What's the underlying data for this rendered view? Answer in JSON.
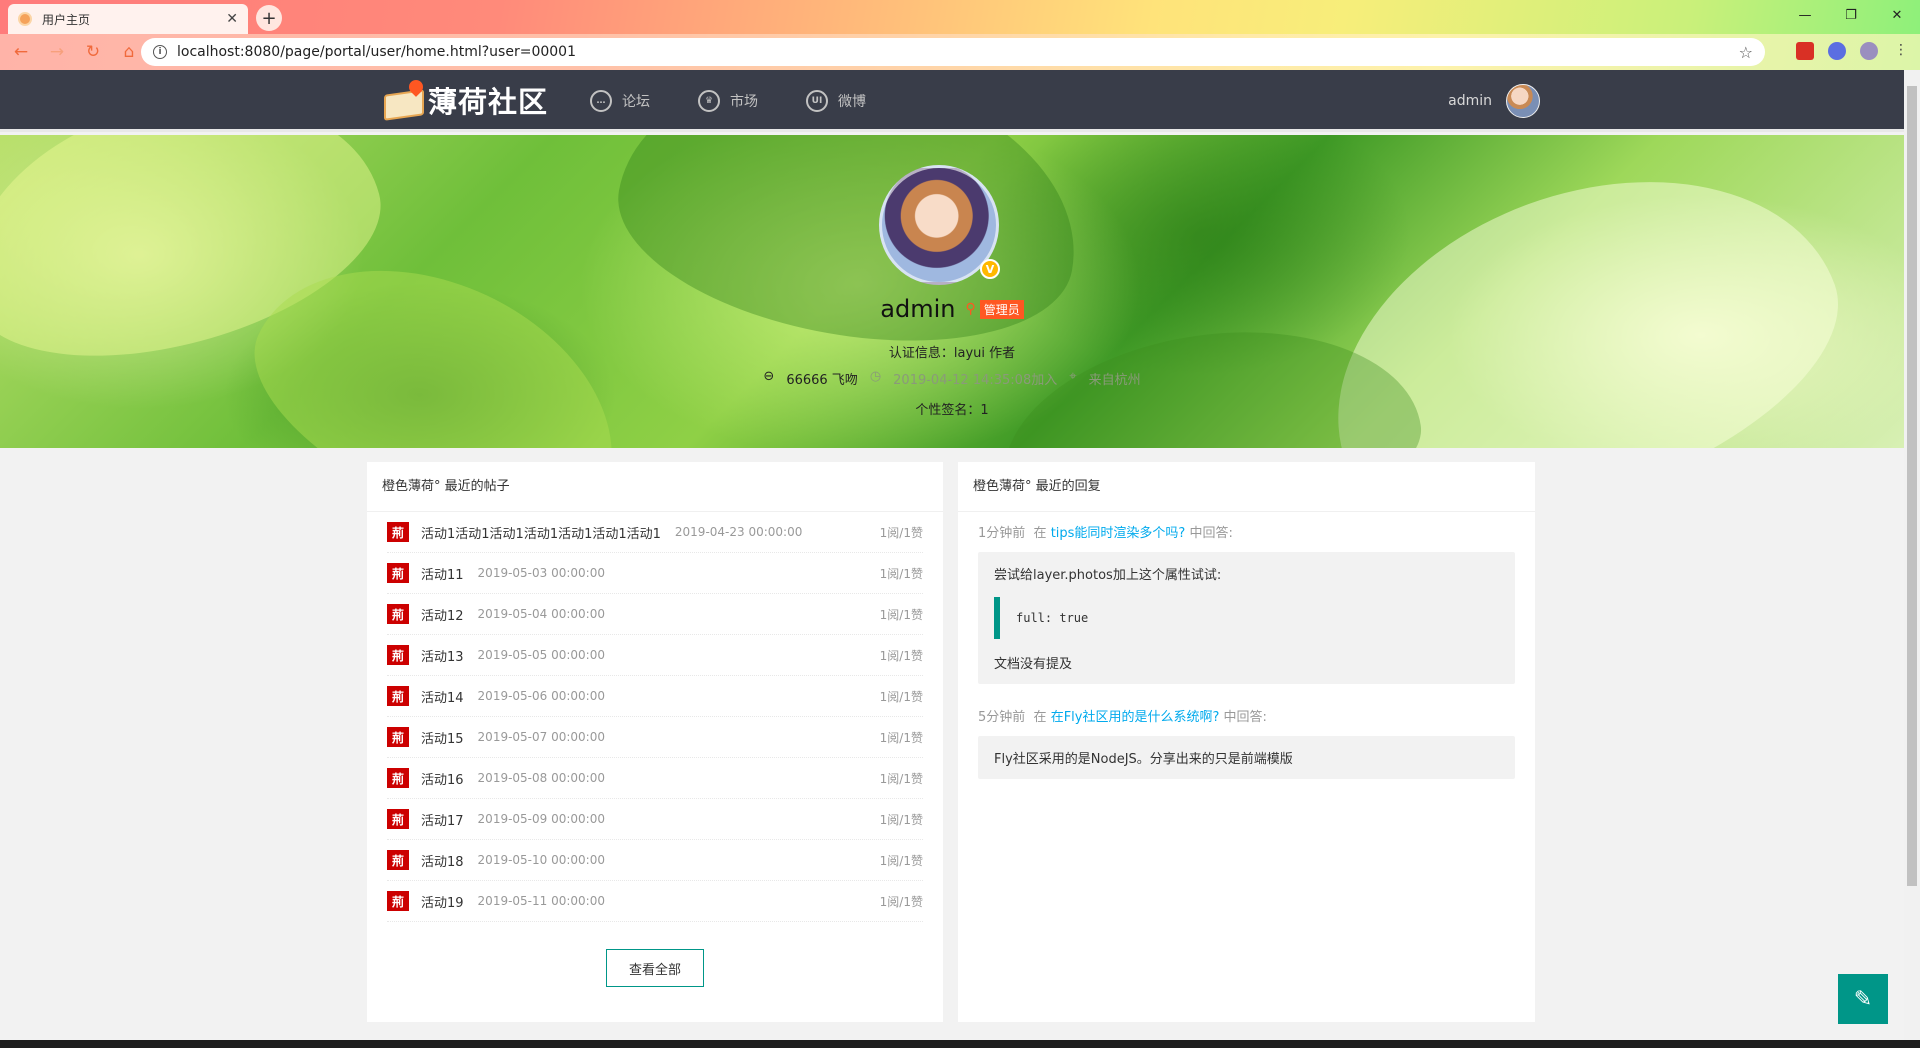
{
  "browser": {
    "tab_title": "用户主页",
    "tab_close": "✕",
    "new_tab": "+",
    "url": "localhost:8080/page/portal/user/home.html?user=00001",
    "win_min": "—",
    "win_restore": "❐",
    "win_close": "✕"
  },
  "header": {
    "logo_text": "薄荷社区",
    "nav": [
      {
        "label": "论坛",
        "icon": "chat-icon"
      },
      {
        "label": "市场",
        "icon": "crown-icon"
      },
      {
        "label": "微博",
        "icon": "ui-icon"
      }
    ],
    "user_name": "admin"
  },
  "profile": {
    "name": "admin",
    "role_badge": "管理员",
    "vip_mark": "V",
    "cert": "认证信息：layui 作者",
    "kisses": "66666 飞吻",
    "joined": "2019-04-12 14:35:08加入",
    "location": "来自杭州",
    "signature": "个性签名：1"
  },
  "posts_panel": {
    "title": "橙色薄荷° 最近的帖子",
    "tag": "荊",
    "items": [
      {
        "title": "活动1活动1活动1活动1活动1活动1活动1",
        "date": "2019-04-23 00:00:00",
        "stat": "1阅/1赞"
      },
      {
        "title": "活动11",
        "date": "2019-05-03 00:00:00",
        "stat": "1阅/1赞"
      },
      {
        "title": "活动12",
        "date": "2019-05-04 00:00:00",
        "stat": "1阅/1赞"
      },
      {
        "title": "活动13",
        "date": "2019-05-05 00:00:00",
        "stat": "1阅/1赞"
      },
      {
        "title": "活动14",
        "date": "2019-05-06 00:00:00",
        "stat": "1阅/1赞"
      },
      {
        "title": "活动15",
        "date": "2019-05-07 00:00:00",
        "stat": "1阅/1赞"
      },
      {
        "title": "活动16",
        "date": "2019-05-08 00:00:00",
        "stat": "1阅/1赞"
      },
      {
        "title": "活动17",
        "date": "2019-05-09 00:00:00",
        "stat": "1阅/1赞"
      },
      {
        "title": "活动18",
        "date": "2019-05-10 00:00:00",
        "stat": "1阅/1赞"
      },
      {
        "title": "活动19",
        "date": "2019-05-11 00:00:00",
        "stat": "1阅/1赞"
      }
    ],
    "view_all": "查看全部"
  },
  "replies_panel": {
    "title": "橙色薄荷° 最近的回复",
    "replies": [
      {
        "time": "1分钟前",
        "in": "在",
        "topic": "tips能同时渲染多个吗?",
        "suffix": "中回答:",
        "line1": "尝试给layer.photos加上这个属性试试:",
        "code": "full: true",
        "line2": "文档没有提及"
      },
      {
        "time": "5分钟前",
        "in": "在",
        "topic": "在Fly社区用的是什么系统啊?",
        "suffix": "中回答:",
        "line1": "Fly社区采用的是NodeJS。分享出来的只是前端模版"
      }
    ]
  },
  "fab_icon": "✎"
}
